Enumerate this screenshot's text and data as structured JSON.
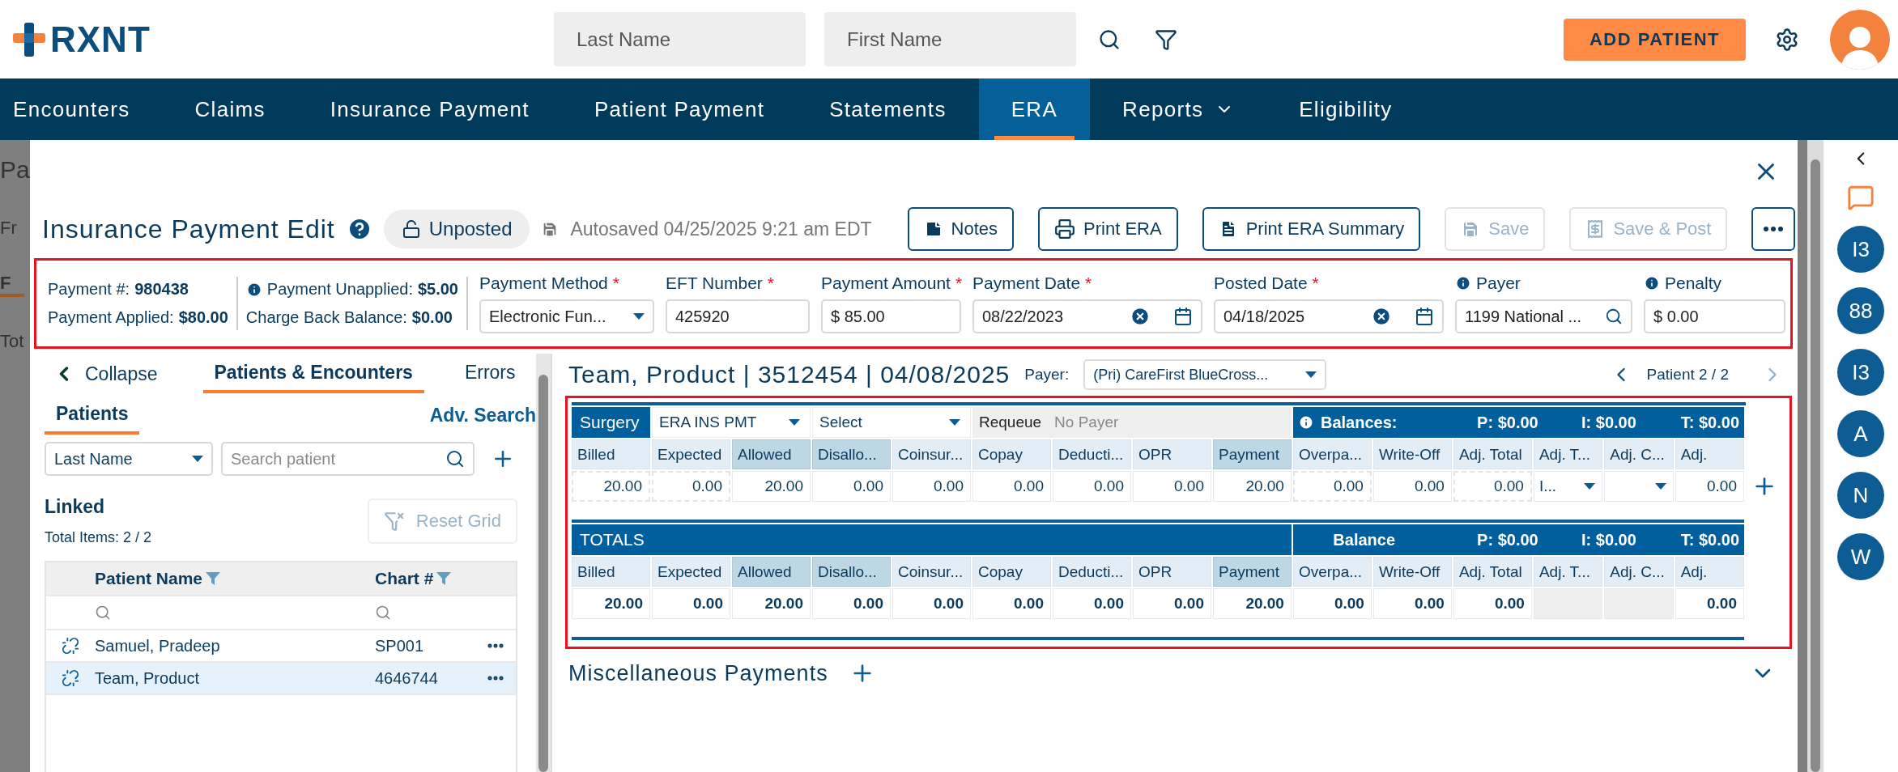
{
  "header": {
    "logo": "RXNT",
    "search_fields": [
      {
        "placeholder": "Last Name"
      },
      {
        "placeholder": "First Name"
      }
    ],
    "add_button": "ADD PATIENT"
  },
  "nav": [
    {
      "label": "Encounters",
      "selected": false,
      "has_menu": false
    },
    {
      "label": "Claims",
      "selected": false,
      "has_menu": false
    },
    {
      "label": "Insurance Payment",
      "selected": false,
      "has_menu": false
    },
    {
      "label": "Patient Payment",
      "selected": false,
      "has_menu": false
    },
    {
      "label": "Statements",
      "selected": false,
      "has_menu": false
    },
    {
      "label": "ERA",
      "selected": true,
      "has_menu": false
    },
    {
      "label": "Reports",
      "selected": false,
      "has_menu": true
    },
    {
      "label": "Eligibility",
      "selected": false,
      "has_menu": false
    }
  ],
  "background": {
    "left_fragments": [
      {
        "text": "Pa",
        "kind": "title"
      },
      {
        "text": "Fr",
        "kind": "text"
      },
      {
        "text": "F",
        "kind": "tab"
      },
      {
        "text": "Tot",
        "kind": "text"
      }
    ],
    "right_badges": [
      "I3",
      "88",
      "I3",
      "A",
      "N",
      "W"
    ]
  },
  "dialog": {
    "title": "Insurance Payment Edit",
    "status": "Unposted",
    "autosaved": "Autosaved 04/25/2025 9:21 am EDT",
    "actions": [
      {
        "label": "Notes",
        "disabled": false
      },
      {
        "label": "Print ERA",
        "disabled": false
      },
      {
        "label": "Print ERA Summary",
        "disabled": false
      },
      {
        "label": "Save",
        "disabled": true
      },
      {
        "label": "Save & Post",
        "disabled": true
      }
    ],
    "summary": {
      "required_mark": "*",
      "stat_groups": [
        [
          {
            "label": "Payment #:",
            "value": "980438",
            "info": false
          },
          {
            "label": "Payment Applied:",
            "value": "$80.00",
            "info": false
          }
        ],
        [
          {
            "label": "Payment Unapplied:",
            "value": "$5.00",
            "info": true
          },
          {
            "label": "Charge Back Balance:",
            "value": "$0.00",
            "info": false
          }
        ]
      ],
      "fields": [
        {
          "label": "Payment Method",
          "required": true,
          "info": false,
          "value": "Electronic Fun...",
          "kind": "select"
        },
        {
          "label": "EFT Number",
          "required": true,
          "info": false,
          "value": "425920",
          "kind": "text"
        },
        {
          "label": "Payment Amount",
          "required": true,
          "info": false,
          "value": "$ 85.00",
          "kind": "text"
        },
        {
          "label": "Payment Date",
          "required": true,
          "info": false,
          "value": "08/22/2023",
          "kind": "date"
        },
        {
          "label": "Posted Date",
          "required": true,
          "info": false,
          "value": "04/18/2025",
          "kind": "date"
        },
        {
          "label": "Payer",
          "required": false,
          "info": true,
          "value": "1199 National ...",
          "kind": "lookup"
        },
        {
          "label": "Penalty",
          "required": false,
          "info": true,
          "value": "$ 0.00",
          "kind": "text"
        }
      ]
    }
  },
  "left_panel": {
    "collapse": "Collapse",
    "tabs": [
      {
        "label": "Patients & Encounters",
        "selected": true
      },
      {
        "label": "Errors",
        "selected": false
      }
    ],
    "subtab": {
      "label": "Patients",
      "selected": true
    },
    "adv_search": "Adv. Search",
    "filter_select": "Last Name",
    "search": {
      "placeholder": "Search patient"
    },
    "section": "Linked",
    "total": "Total Items: 2 / 2",
    "reset": "Reset Grid",
    "columns": [
      "Patient Name",
      "Chart #"
    ],
    "rows": [
      {
        "name": "Samuel, Pradeep",
        "chart": "SP001",
        "selected": false
      },
      {
        "name": "Team, Product",
        "chart": "4646744",
        "selected": true
      }
    ]
  },
  "encounter": {
    "title": "Team, Product | 3512454 | 04/08/2025",
    "payer_label": "Payer:",
    "payer": "(Pri) CareFirst BlueCross...",
    "pager": "Patient 2 / 2",
    "line": {
      "type": "Surgery",
      "code": "ERA INS PMT",
      "select": "Select",
      "requeue": "Requeue",
      "requeue_value": "No Payer",
      "balance_label": "Balances:",
      "balances": [
        "P: $0.00",
        "I: $0.00",
        "T: $0.00"
      ]
    },
    "columns": [
      {
        "label": "Billed",
        "highlight": false
      },
      {
        "label": "Expected",
        "highlight": false
      },
      {
        "label": "Allowed",
        "highlight": true
      },
      {
        "label": "Disallo...",
        "highlight": true
      },
      {
        "label": "Coinsur...",
        "highlight": false
      },
      {
        "label": "Copay",
        "highlight": false
      },
      {
        "label": "Deducti...",
        "highlight": false
      },
      {
        "label": "OPR",
        "highlight": false
      },
      {
        "label": "Payment",
        "highlight": true
      },
      {
        "label": "Overpa...",
        "highlight": false
      },
      {
        "label": "Write-Off",
        "highlight": false
      },
      {
        "label": "Adj. Total",
        "highlight": false
      },
      {
        "label": "Adj. T...",
        "highlight": false
      },
      {
        "label": "Adj. C...",
        "highlight": false
      },
      {
        "label": "Adj.",
        "highlight": false
      }
    ],
    "line_values": [
      {
        "kind": "dashed",
        "value": "20.00"
      },
      {
        "kind": "dashed",
        "value": "0.00"
      },
      {
        "kind": "plain",
        "value": "20.00"
      },
      {
        "kind": "plain",
        "value": "0.00"
      },
      {
        "kind": "plain",
        "value": "0.00"
      },
      {
        "kind": "plain",
        "value": "0.00"
      },
      {
        "kind": "plain",
        "value": "0.00"
      },
      {
        "kind": "plain",
        "value": "0.00"
      },
      {
        "kind": "plain",
        "value": "20.00"
      },
      {
        "kind": "dashed",
        "value": "0.00"
      },
      {
        "kind": "plain",
        "value": "0.00"
      },
      {
        "kind": "dashed",
        "value": "0.00"
      },
      {
        "kind": "select",
        "value": "I..."
      },
      {
        "kind": "select"
      },
      {
        "kind": "plain",
        "value": "0.00"
      }
    ],
    "totals_columns": [
      {
        "label": "Billed",
        "highlight": false
      },
      {
        "label": "Expected",
        "highlight": false
      },
      {
        "label": "Allowed",
        "highlight": true
      },
      {
        "label": "Disallo...",
        "highlight": true
      },
      {
        "label": "Coinsur...",
        "highlight": false
      },
      {
        "label": "Copay",
        "highlight": false
      },
      {
        "label": "Deducti...",
        "highlight": false
      },
      {
        "label": "OPR",
        "highlight": false
      },
      {
        "label": "Payment",
        "highlight": true
      },
      {
        "label": "Overpa...",
        "highlight": false
      },
      {
        "label": "Write-Off",
        "highlight": false
      },
      {
        "label": "Adj. Total",
        "highlight": false
      },
      {
        "label": "Adj. T...",
        "highlight": false
      },
      {
        "label": "Adj. C...",
        "highlight": false
      },
      {
        "label": "Adj.",
        "highlight": false
      }
    ],
    "totals_label": "TOTALS",
    "totals_balance_label": "Balance",
    "totals_balances": [
      "P: $0.00",
      "I: $0.00",
      "T: $0.00"
    ],
    "totals_values": [
      {
        "kind": "value",
        "value": "20.00"
      },
      {
        "kind": "value",
        "value": "0.00"
      },
      {
        "kind": "value",
        "value": "20.00"
      },
      {
        "kind": "value",
        "value": "0.00"
      },
      {
        "kind": "value",
        "value": "0.00"
      },
      {
        "kind": "value",
        "value": "0.00"
      },
      {
        "kind": "value",
        "value": "0.00"
      },
      {
        "kind": "value",
        "value": "0.00"
      },
      {
        "kind": "value",
        "value": "20.00"
      },
      {
        "kind": "value",
        "value": "0.00"
      },
      {
        "kind": "value",
        "value": "0.00"
      },
      {
        "kind": "value",
        "value": "0.00"
      },
      {
        "kind": "blank"
      },
      {
        "kind": "blank"
      },
      {
        "kind": "value",
        "value": "0.00"
      }
    ],
    "misc": "Miscellaneous Payments"
  }
}
